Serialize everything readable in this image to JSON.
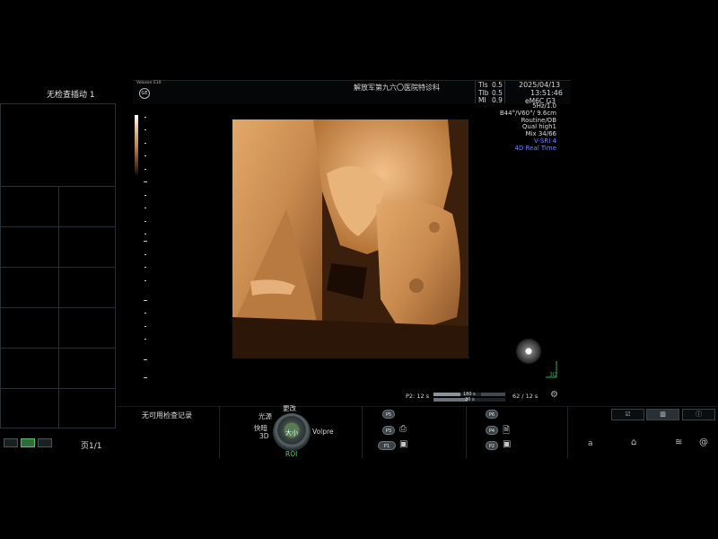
{
  "left_panel": {
    "title": "无检查插动 1",
    "page_indicator": "页1/1"
  },
  "header": {
    "logo_text": "Voluson E10",
    "logo_mark": "GE",
    "hospital": "解放军第九六〇医院特诊科",
    "indices": [
      {
        "label": "TIs",
        "value": "0.5"
      },
      {
        "label": "TIb",
        "value": "0.5"
      },
      {
        "label": "MI",
        "value": "0.9"
      }
    ],
    "date": "2025/04/13",
    "time": "13:51:46"
  },
  "right_info": {
    "lines": [
      "5Hz/1.0",
      "B44°/V60°/ 9.6cm",
      "Routine/OB",
      "Qual high1",
      "Mix 34/66"
    ],
    "probe": "eM6C G3",
    "vsri": "V-SRI 4",
    "mode": "4D Real Time"
  },
  "image": {
    "label_3d": "3D"
  },
  "cine": {
    "p2_label": "P2:  12 s",
    "bar_top": "180 s",
    "bar_bottom": "36 s",
    "count": "62 / 12 s"
  },
  "bottom": {
    "no_records": "无可用检查记录",
    "knob": {
      "top": "更改",
      "left_top": "光源",
      "left_mid": "快暗",
      "left_bottom": "3D",
      "right": "Volpre",
      "bottom": "ROI",
      "center": "大小"
    },
    "p_buttons_left": [
      "P5",
      "P3",
      "P1"
    ],
    "p_buttons_right": [
      "P6",
      "P4",
      "P2"
    ],
    "status_letter": "a"
  },
  "icons": {
    "settings": "gear-icon",
    "orientation": "orientation-ball-icon"
  },
  "colors": {
    "accent_green": "#53d26a",
    "info_blue": "#6f84ff",
    "render_skin": "#c98a4e"
  }
}
